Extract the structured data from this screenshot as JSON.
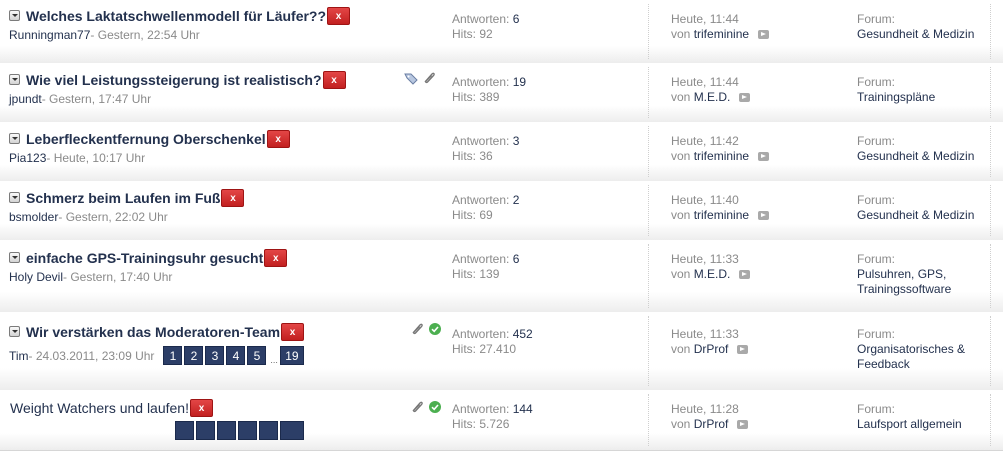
{
  "labels": {
    "replies": "Antworten: ",
    "hits": "Hits: ",
    "by": "von ",
    "forum": "Forum:",
    "delete": "x",
    "ellipsis": "..."
  },
  "threads": [
    {
      "title": "Welches Laktatschwellenmodell für Läufer??",
      "author": "Runningman77",
      "date": " - Gestern, 22:54 Uhr",
      "replies": "6",
      "hits": "92",
      "last_time": "Heute, 11:44",
      "last_user": "trifeminine",
      "forum": "Gesundheit & Medizin"
    },
    {
      "title": "Wie viel Leistungssteigerung ist realistisch?",
      "author": "jpundt",
      "date": " - Gestern, 17:47 Uhr",
      "replies": "19",
      "hits": "389",
      "last_time": "Heute, 11:44",
      "last_user": "M.E.D.",
      "forum": "Trainingspläne",
      "icons": [
        "tag-icon",
        "paperclip-icon"
      ]
    },
    {
      "title": "Leberfleckentfernung Oberschenkel",
      "author": "Pia123",
      "date": " - Heute, 10:17 Uhr",
      "replies": "3",
      "hits": "36",
      "last_time": "Heute, 11:42",
      "last_user": "trifeminine",
      "forum": "Gesundheit & Medizin"
    },
    {
      "title": "Schmerz beim Laufen im Fuß",
      "author": "bsmolder",
      "date": " - Gestern, 22:02 Uhr",
      "replies": "2",
      "hits": "69",
      "last_time": "Heute, 11:40",
      "last_user": "trifeminine",
      "forum": "Gesundheit & Medizin"
    },
    {
      "title": "einfache GPS-Trainingsuhr gesucht",
      "author": "Holy Devil",
      "date": " - Gestern, 17:40 Uhr",
      "replies": "6",
      "hits": "139",
      "last_time": "Heute, 11:33",
      "last_user": "M.E.D.",
      "forum_lines": [
        "Pulsuhren, GPS,",
        "Trainingssoftware"
      ]
    },
    {
      "title": "Wir verstärken das Moderatoren-Team",
      "author": "Tim",
      "date": " - 24.03.2011, 23:09 Uhr",
      "pages": [
        "1",
        "2",
        "3",
        "4",
        "5"
      ],
      "last_page": "19",
      "replies": "452",
      "hits": "27.410",
      "last_time": "Heute, 11:33",
      "last_user": "DrProf",
      "forum_lines": [
        "Organisatorisches &",
        "Feedback"
      ],
      "icons": [
        "paperclip-icon",
        "check-icon"
      ]
    },
    {
      "title": "Weight Watchers und laufen!",
      "replies": "144",
      "hits": "5.726",
      "last_time": "Heute, 11:28",
      "last_user": "DrProf",
      "forum": "Laufsport allgemein",
      "icons": [
        "paperclip-icon",
        "check-icon"
      ]
    }
  ],
  "colors": {
    "link": "#23314e",
    "muted": "#8a8a8a",
    "delete_button": "#d63333",
    "page_button": "#2c3e67",
    "check": "#4caf50"
  }
}
